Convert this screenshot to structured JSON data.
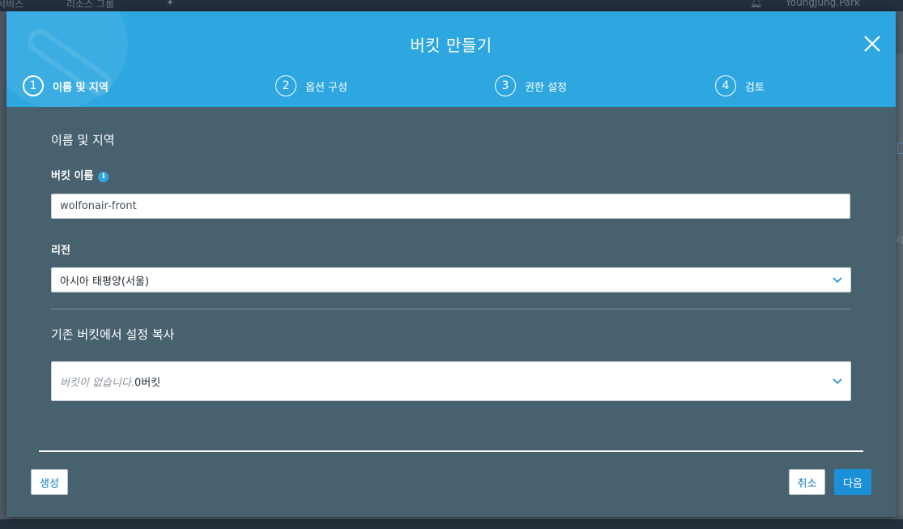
{
  "background": {
    "topbar_left_1": "서비스",
    "topbar_left_2": "리소스 그룹",
    "topbar_user": "YoungJung.Park"
  },
  "modal": {
    "title": "버킷 만들기",
    "steps": [
      {
        "number": "1",
        "label": "이름 및 지역",
        "active": true
      },
      {
        "number": "2",
        "label": "옵션 구성",
        "active": false
      },
      {
        "number": "3",
        "label": "권한 설정",
        "active": false
      },
      {
        "number": "4",
        "label": "검토",
        "active": false
      }
    ],
    "section_title": "이름 및 지역",
    "bucket_name_label": "버킷 이름",
    "bucket_name_value": "wolfonair-front",
    "region_label": "리전",
    "region_value": "아시아 태평양(서울)",
    "copy_title": "기존 버킷에서 설정 복사",
    "copy_placeholder": "버킷이 없습니다.",
    "copy_count": "0버킷",
    "buttons": {
      "create": "생성",
      "cancel": "취소",
      "next": "다음"
    }
  },
  "colors": {
    "header": "#2ea7e0",
    "modal_body": "#47616f",
    "primary_button": "#1b8fd8"
  },
  "icons": {
    "close": "close-icon",
    "info": "info-icon",
    "dropdown": "chevron-down-icon"
  }
}
